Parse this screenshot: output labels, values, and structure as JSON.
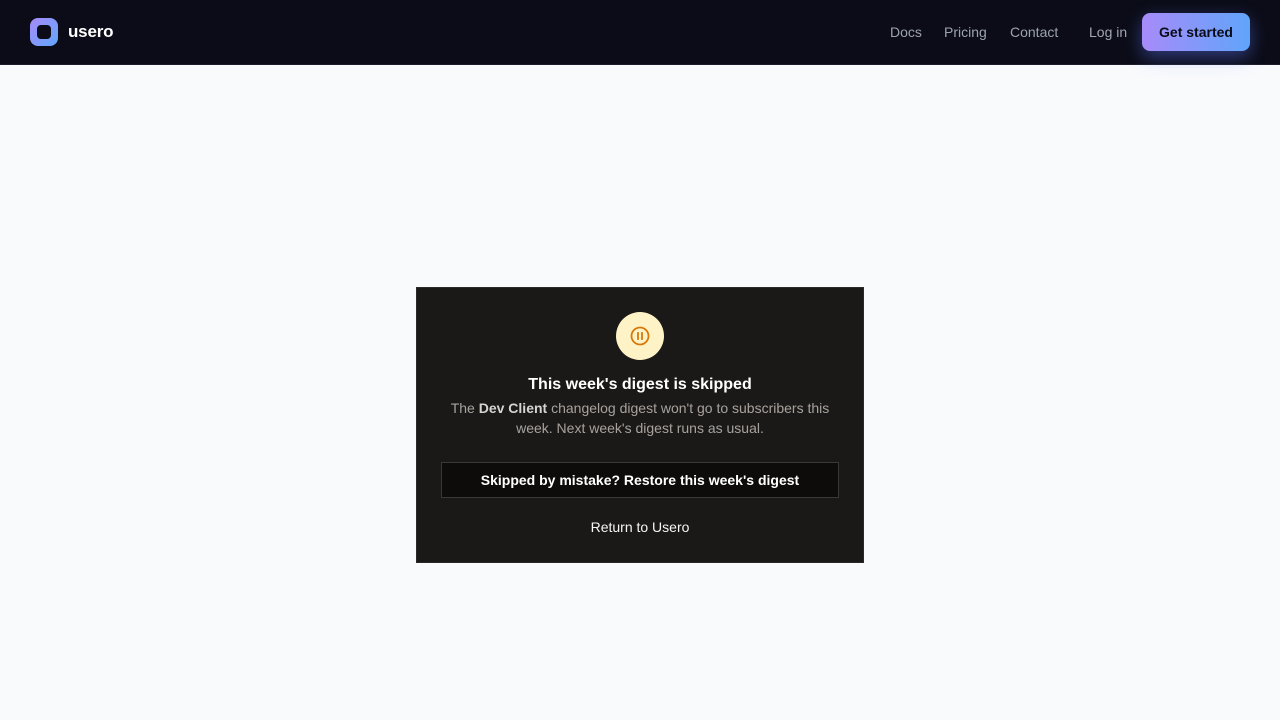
{
  "header": {
    "brand_name": "usero",
    "nav": {
      "docs": "Docs",
      "pricing": "Pricing",
      "contact": "Contact"
    },
    "login_label": "Log in",
    "cta_label": "Get started"
  },
  "card": {
    "icon": "pause-circle-icon",
    "title": "This week's digest is skipped",
    "body_prefix": "The",
    "project_name": "Dev Client",
    "body_suffix": "changelog digest won't go to subscribers this week. Next week's digest runs as usual.",
    "restore_label": "Skipped by mistake? Restore this week's digest",
    "return_label": "Return to Usero"
  },
  "colors": {
    "accent_gradient_start": "#a78bfa",
    "accent_gradient_end": "#60a5fa",
    "warning_icon": "#d97706",
    "warning_icon_bg": "#fef3c7"
  }
}
